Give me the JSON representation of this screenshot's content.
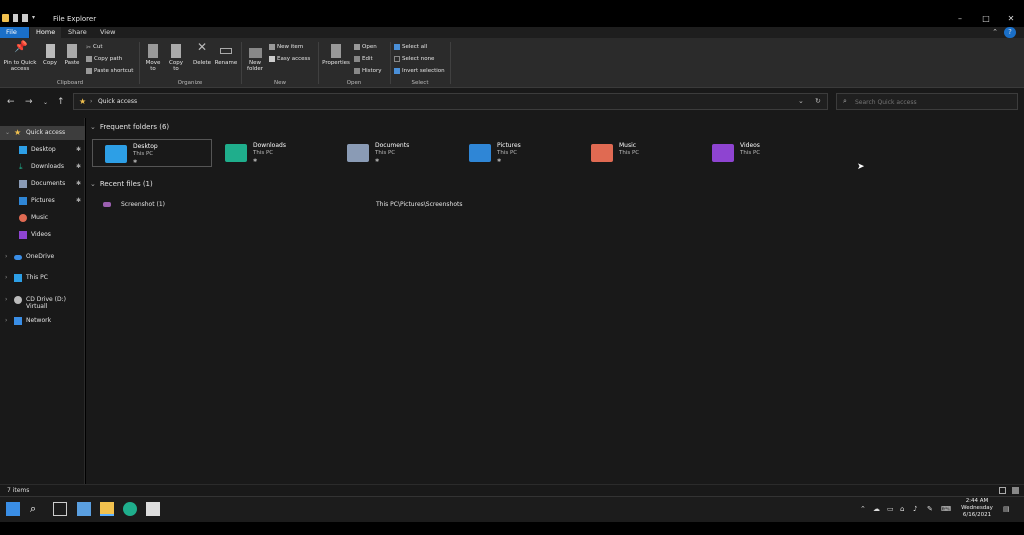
{
  "window": {
    "title": "File Explorer"
  },
  "tabs": [
    "File",
    "Home",
    "Share",
    "View"
  ],
  "ribbon": {
    "clipboard": {
      "pin": "Pin to Quick access",
      "copy": "Copy",
      "paste": "Paste",
      "cut": "Cut",
      "copy_path": "Copy path",
      "paste_shortcut": "Paste shortcut",
      "label": "Clipboard"
    },
    "organize": {
      "move_to": "Move to",
      "copy_to": "Copy to",
      "delete": "Delete",
      "rename": "Rename",
      "label": "Organize"
    },
    "new": {
      "new_folder": "New folder",
      "new_item": "New item",
      "easy_access": "Easy access",
      "label": "New"
    },
    "open": {
      "properties": "Properties",
      "open": "Open",
      "edit": "Edit",
      "history": "History",
      "label": "Open"
    },
    "select": {
      "select_all": "Select all",
      "select_none": "Select none",
      "invert": "Invert selection",
      "label": "Select"
    }
  },
  "address": {
    "path": "Quick access"
  },
  "search": {
    "placeholder": "Search Quick access"
  },
  "sidebar": {
    "items": [
      {
        "label": "Quick access"
      },
      {
        "label": "Desktop"
      },
      {
        "label": "Downloads"
      },
      {
        "label": "Documents"
      },
      {
        "label": "Pictures"
      },
      {
        "label": "Music"
      },
      {
        "label": "Videos"
      },
      {
        "label": "OneDrive"
      },
      {
        "label": "This PC"
      },
      {
        "label": "CD Drive (D:) Virtuall"
      },
      {
        "label": "Network"
      }
    ]
  },
  "main": {
    "frequent_title": "Frequent folders (6)",
    "folders": [
      {
        "name": "Desktop",
        "location": "This PC"
      },
      {
        "name": "Downloads",
        "location": "This PC"
      },
      {
        "name": "Documents",
        "location": "This PC"
      },
      {
        "name": "Pictures",
        "location": "This PC"
      },
      {
        "name": "Music",
        "location": "This PC"
      },
      {
        "name": "Videos",
        "location": "This PC"
      }
    ],
    "recent_title": "Recent files (1)",
    "recent": [
      {
        "name": "Screenshot (1)",
        "path": "This PC\\Pictures\\Screenshots"
      }
    ]
  },
  "status": {
    "items": "7 items"
  },
  "clock": {
    "time": "2:44 AM",
    "day": "Wednesday",
    "date": "6/16/2021"
  },
  "colors": {
    "accent": "#1a6fc8",
    "desktop": "#2d9fe6",
    "downloads": "#1fae8c",
    "documents": "#8a9bb5",
    "pictures": "#2f86d6",
    "music": "#e06a52",
    "videos": "#8e44d1",
    "folder": "#f2c14e"
  }
}
